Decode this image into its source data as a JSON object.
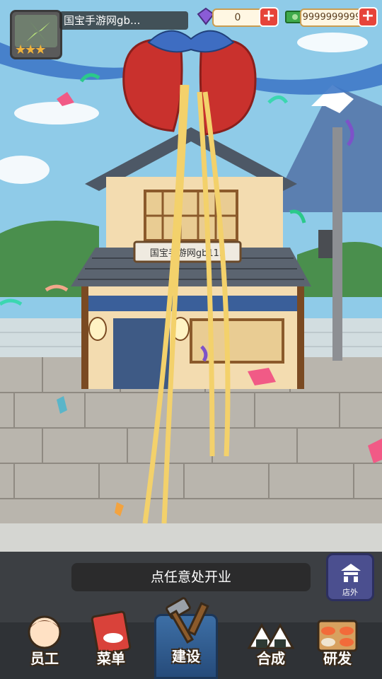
{
  "hud": {
    "shop_name": "国宝手游网gb...",
    "stars": "★★★",
    "gems": "0",
    "cash": "9999999999",
    "plus": "+"
  },
  "shop_sign": "国宝手游网gb115",
  "hint": "点任意处开业",
  "outside_button": {
    "label": "店外"
  },
  "nav": [
    {
      "label": "员工"
    },
    {
      "label": "菜单"
    },
    {
      "label": "建设"
    },
    {
      "label": "合成"
    },
    {
      "label": "研发"
    }
  ],
  "colors": {
    "sky": "#8fcbe8",
    "ribbon_gold": "#f3d16b",
    "nav_active": "#3d6fa6"
  }
}
